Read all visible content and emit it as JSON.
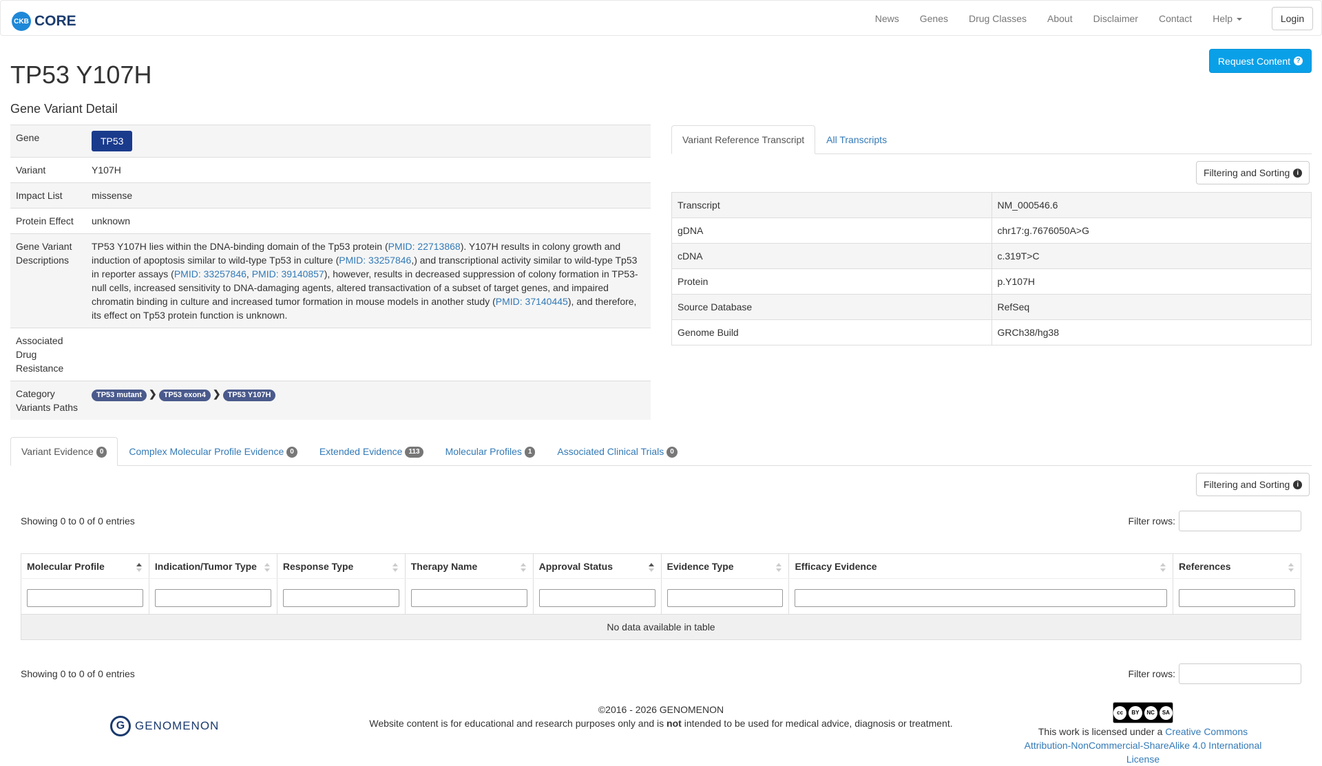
{
  "navbar": {
    "logo_text": "CKB",
    "brand": "CORE",
    "links": [
      "News",
      "Genes",
      "Drug Classes",
      "About",
      "Disclaimer",
      "Contact",
      "Help"
    ],
    "login": "Login"
  },
  "header": {
    "title": "TP53 Y107H",
    "subtitle": "Gene Variant Detail",
    "request_button": "Request Content"
  },
  "detail": {
    "gene_label": "Gene",
    "gene_value": "TP53",
    "variant_label": "Variant",
    "variant_value": "Y107H",
    "impact_label": "Impact List",
    "impact_value": "missense",
    "protein_effect_label": "Protein Effect",
    "protein_effect_value": "unknown",
    "descriptions_label": "Gene Variant Descriptions",
    "desc": {
      "t1": "TP53 Y107H lies within the DNA-binding domain of the Tp53 protein (",
      "l1": "PMID: 22713868",
      "t2": "). Y107H results in colony growth and induction of apoptosis similar to wild-type Tp53 in culture (",
      "l2": "PMID: 33257846",
      "t3": ",) and transcriptional activity similar to wild-type Tp53 in reporter assays (",
      "l3": "PMID: 33257846",
      "t4": ", ",
      "l4": "PMID: 39140857",
      "t5": "), however, results in decreased suppression of colony formation in TP53-null cells, increased sensitivity to DNA-damaging agents, altered transactivation of a subset of target genes, and impaired chromatin binding in culture and increased tumor formation in mouse models in another study (",
      "l5": "PMID: 37140445",
      "t6": "), and therefore, its effect on Tp53 protein function is unknown."
    },
    "drug_resistance_label": "Associated Drug Resistance",
    "category_label": "Category Variants Paths",
    "paths": [
      "TP53 mutant",
      "TP53 exon4",
      "TP53 Y107H"
    ]
  },
  "transcript_tabs": [
    "Variant Reference Transcript",
    "All Transcripts"
  ],
  "filter_sort_label": "Filtering and Sorting",
  "transcript": [
    {
      "label": "Transcript",
      "value": "NM_000546.6"
    },
    {
      "label": "gDNA",
      "value": "chr17:g.7676050A>G"
    },
    {
      "label": "cDNA",
      "value": "c.319T>C"
    },
    {
      "label": "Protein",
      "value": "p.Y107H"
    },
    {
      "label": "Source Database",
      "value": "RefSeq"
    },
    {
      "label": "Genome Build",
      "value": "GRCh38/hg38"
    }
  ],
  "evidence_tabs": [
    {
      "label": "Variant Evidence",
      "count": "0"
    },
    {
      "label": "Complex Molecular Profile Evidence",
      "count": "0"
    },
    {
      "label": "Extended Evidence",
      "count": "113"
    },
    {
      "label": "Molecular Profiles",
      "count": "1"
    },
    {
      "label": "Associated Clinical Trials",
      "count": "0"
    }
  ],
  "evidence": {
    "showing": "Showing 0 to 0 of 0 entries",
    "filter_rows": "Filter rows:",
    "columns": [
      "Molecular Profile",
      "Indication/Tumor Type",
      "Response Type",
      "Therapy Name",
      "Approval Status",
      "Evidence Type",
      "Efficacy Evidence",
      "References"
    ],
    "empty": "No data available in table"
  },
  "footer": {
    "company": "GENOMENON",
    "copyright": "©2016 - 2026 GENOMENON",
    "disclaimer_pre": "Website content is for educational and research purposes only and is ",
    "disclaimer_bold": "not",
    "disclaimer_post": " intended to be used for medical advice, diagnosis or treatment.",
    "license_pre": "This work is licensed under a ",
    "license_link": "Creative Commons Attribution-NonCommercial-ShareAlike 4.0 International License",
    "cc_badge": [
      "cc",
      "BY",
      "NC",
      "SA"
    ]
  }
}
